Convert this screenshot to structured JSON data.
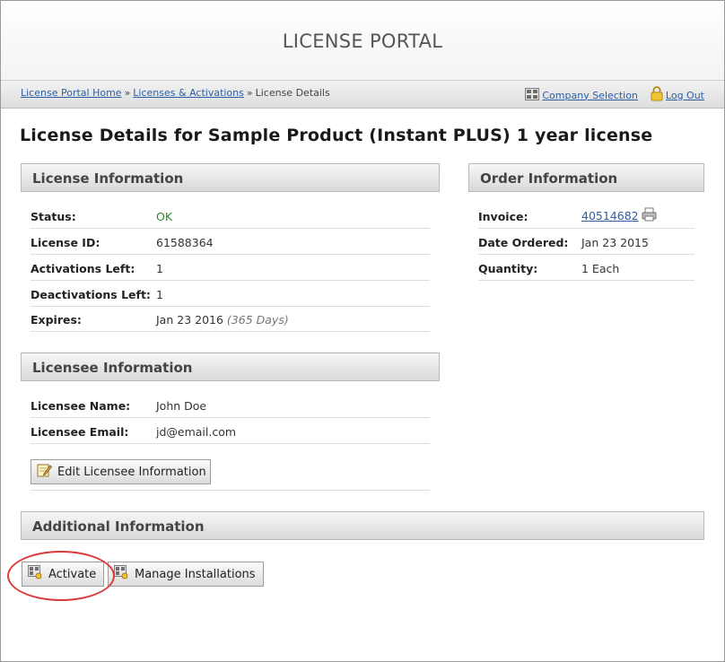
{
  "header": {
    "title": "LICENSE PORTAL"
  },
  "breadcrumb": {
    "items": [
      "License Portal Home",
      "Licenses & Activations",
      "License Details"
    ],
    "separator": "»"
  },
  "nav_right": {
    "company_selection": "Company Selection",
    "logout": "Log Out"
  },
  "page_title": "License Details for Sample Product (Instant PLUS) 1 year license",
  "license_info": {
    "title": "License Information",
    "rows": [
      {
        "label": "Status:",
        "value": "OK"
      },
      {
        "label": "License ID:",
        "value": "61588364"
      },
      {
        "label": "Activations Left:",
        "value": "1"
      },
      {
        "label": "Deactivations Left:",
        "value": "1"
      },
      {
        "label": "Expires:",
        "value": "Jan 23 2016",
        "note": "(365 Days)"
      }
    ]
  },
  "order_info": {
    "title": "Order Information",
    "rows": [
      {
        "label": "Invoice:",
        "value": "40514682"
      },
      {
        "label": "Date Ordered:",
        "value": "Jan 23 2015"
      },
      {
        "label": "Quantity:",
        "value": "1 Each"
      }
    ]
  },
  "licensee_info": {
    "title": "Licensee Information",
    "rows": [
      {
        "label": "Licensee Name:",
        "value": "John Doe"
      },
      {
        "label": "Licensee Email:",
        "value": "jd@email.com"
      }
    ],
    "edit_button": "Edit Licensee Information"
  },
  "additional_info": {
    "title": "Additional Information",
    "activate_button": "Activate",
    "manage_button": "Manage Installations"
  },
  "colors": {
    "link": "#2a5fa8",
    "status_ok": "#2a8a2a",
    "highlight": "#d83a3a"
  },
  "icons": {
    "company_selection": "grid-icon",
    "logout": "lock-icon",
    "invoice": "printer-icon",
    "edit": "pencil-note-icon",
    "activate": "grid-key-icon",
    "manage": "grid-key-icon"
  }
}
